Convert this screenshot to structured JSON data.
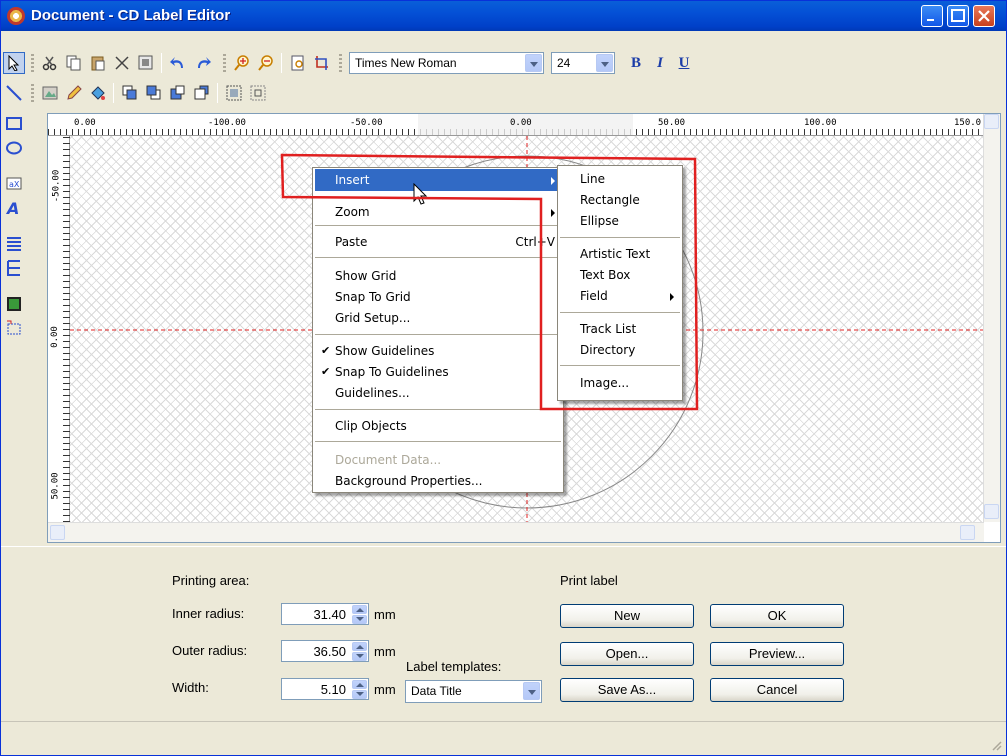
{
  "window": {
    "title": "Document - CD Label Editor",
    "accent": "#0450d6"
  },
  "toolbar": {
    "tool_icons": [
      "select-arrow-icon",
      "cut-icon",
      "copy-icon",
      "paste-icon",
      "delete-icon",
      "properties-icon",
      "undo-icon",
      "redo-icon",
      "zoom-in-icon",
      "zoom-out-icon",
      "page-icon",
      "crop-icon"
    ],
    "font_name": "Times New Roman",
    "font_size": "24",
    "bold": "B",
    "italic": "I",
    "underline": "U"
  },
  "ruler": {
    "top_labels": [
      "0.00",
      "-100.00",
      "-50.00",
      "0.00",
      "50.00",
      "100.00",
      "150.0"
    ],
    "left_labels": [
      "-50.00",
      "0.00",
      "50.00"
    ]
  },
  "context_menu": {
    "items": [
      {
        "label": "Insert",
        "submenu": true,
        "highlighted": true
      },
      {
        "label": "Zoom",
        "submenu": true
      },
      {
        "label": "Paste",
        "shortcut": "Ctrl+V"
      },
      {
        "label": "Show Grid"
      },
      {
        "label": "Snap To Grid"
      },
      {
        "label": "Grid Setup..."
      },
      {
        "label": "Show Guidelines",
        "checked": true
      },
      {
        "label": "Snap To Guidelines",
        "checked": true
      },
      {
        "label": "Guidelines..."
      },
      {
        "label": "Clip Objects"
      },
      {
        "label": "Document Data...",
        "disabled": true
      },
      {
        "label": "Background Properties..."
      }
    ]
  },
  "insert_submenu": {
    "items": [
      {
        "label": "Line"
      },
      {
        "label": "Rectangle"
      },
      {
        "label": "Ellipse"
      },
      {
        "label": "Artistic Text"
      },
      {
        "label": "Text Box"
      },
      {
        "label": "Field",
        "submenu": true
      },
      {
        "label": "Track List"
      },
      {
        "label": "Directory"
      },
      {
        "label": "Image..."
      }
    ]
  },
  "printing_area": {
    "heading": "Printing area:",
    "inner_radius_label": "Inner radius:",
    "inner_radius_value": "31.40",
    "outer_radius_label": "Outer radius:",
    "outer_radius_value": "36.50",
    "width_label": "Width:",
    "width_value": "5.10",
    "unit": "mm"
  },
  "label_templates": {
    "label": "Label templates:",
    "selected": "Data Title"
  },
  "print_label": {
    "heading": "Print label",
    "new": "New",
    "open": "Open...",
    "save_as": "Save As...",
    "ok": "OK",
    "preview": "Preview...",
    "cancel": "Cancel"
  }
}
